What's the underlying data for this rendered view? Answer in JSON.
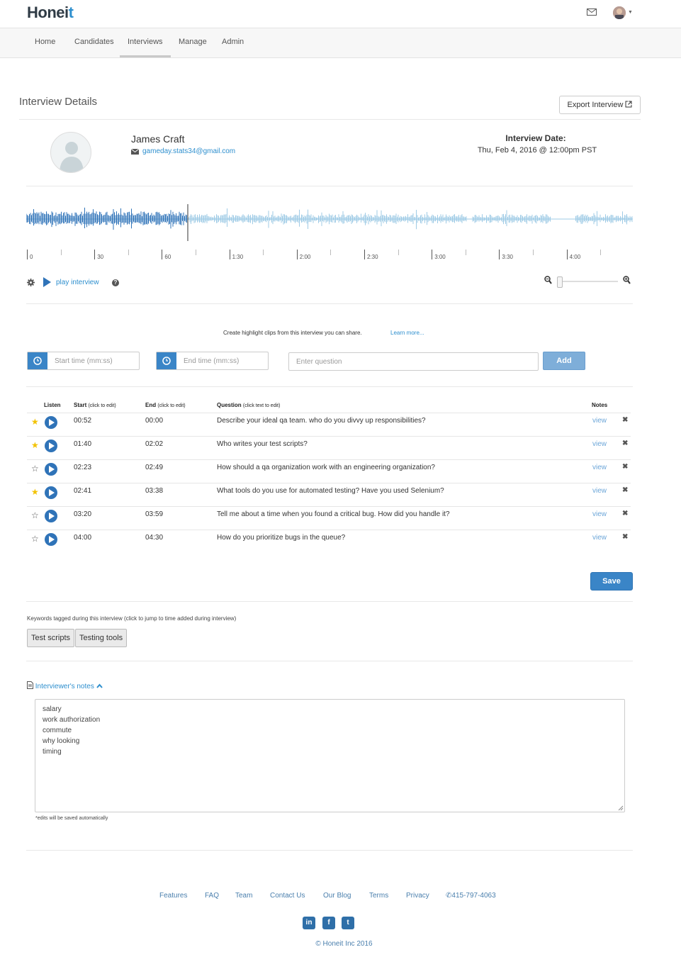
{
  "brand": {
    "logo_a": "Honei",
    "logo_b": "t"
  },
  "nav": {
    "items": [
      "Home",
      "Candidates",
      "Interviews",
      "Manage",
      "Admin"
    ],
    "active": "Interviews"
  },
  "page": {
    "title": "Interview Details",
    "export_label": "Export Interview"
  },
  "candidate": {
    "name": "James Craft",
    "email": "gameday.stats34@gmail.com"
  },
  "interview": {
    "date_label": "Interview Date:",
    "date_value": "Thu, Feb 4, 2016 @ 12:00pm PST"
  },
  "player": {
    "play_label": "play interview",
    "help_glyph": "?",
    "timeline_labels": [
      "0",
      "30",
      "60",
      "1:30",
      "2:00",
      "2:30",
      "3:00",
      "3:30",
      "4:00"
    ],
    "playhead_fraction": 0.27,
    "zoom_level": 0.0
  },
  "clips": {
    "info": "Create highlight clips from this interview you can share.",
    "learn_more": "Learn more...",
    "start_placeholder": "Start time (mm:ss)",
    "end_placeholder": "End time (mm:ss)",
    "question_placeholder": "Enter question",
    "add_label": "Add"
  },
  "table": {
    "headers": {
      "listen": "Listen",
      "start": "Start",
      "start_hint": "(click to edit)",
      "end": "End",
      "end_hint": "(click to edit)",
      "question": "Question",
      "question_hint": "(click text to edit)",
      "notes": "Notes"
    },
    "view_label": "view",
    "rows": [
      {
        "starred": true,
        "start": "00:52",
        "end": "00:00",
        "question": "Describe your ideal qa team. who do you divvy up responsibilities?"
      },
      {
        "starred": true,
        "start": "01:40",
        "end": "02:02",
        "question": "Who writes your test scripts?"
      },
      {
        "starred": false,
        "start": "02:23",
        "end": "02:49",
        "question": "How should a qa organization work with an engineering organization?"
      },
      {
        "starred": true,
        "start": "02:41",
        "end": "03:38",
        "question": "What tools do you use for automated testing? Have you used Selenium?"
      },
      {
        "starred": false,
        "start": "03:20",
        "end": "03:59",
        "question": "Tell me about a time when you found a critical bug. How did you handle it?"
      },
      {
        "starred": false,
        "start": "04:00",
        "end": "04:30",
        "question": "How do you prioritize bugs in the queue?"
      }
    ],
    "save_label": "Save"
  },
  "keywords": {
    "info": "Keywords tagged during this interview (click to jump to time added during interview)",
    "tags": [
      "Test scripts",
      "Testing tools"
    ]
  },
  "notes": {
    "heading": "Interviewer's notes",
    "lines": [
      "salary",
      "work authorization",
      "commute",
      "why looking",
      "timing"
    ],
    "autosave": "*edits will be saved automatically"
  },
  "footer": {
    "links": [
      "Features",
      "FAQ",
      "Team",
      "Contact Us",
      "Our Blog",
      "Terms",
      "Privacy"
    ],
    "phone": "415-797-4063",
    "social": [
      "in",
      "f",
      "t"
    ],
    "copyright": "© Honeit Inc 2016"
  },
  "colors": {
    "accent": "#2e8fce",
    "wave_played": "#2f73b8",
    "wave_unplayed": "#9fcbe6",
    "star": "#f2c200"
  }
}
